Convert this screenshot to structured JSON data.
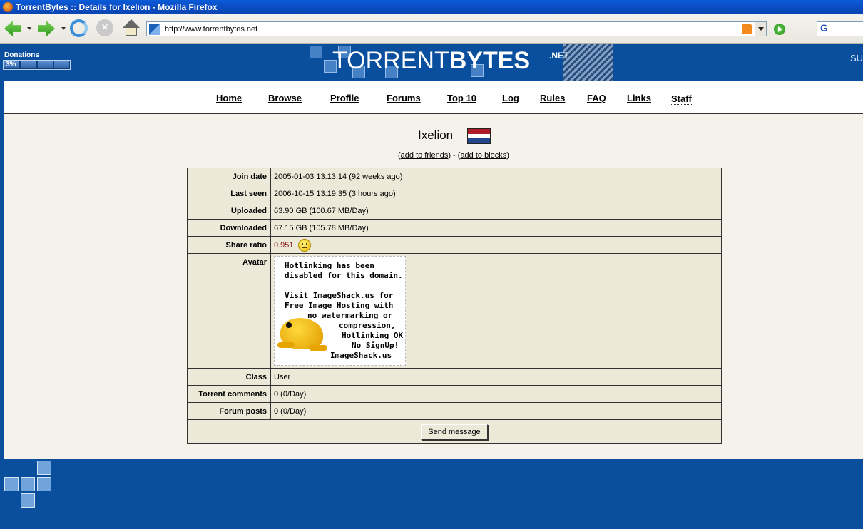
{
  "window": {
    "title": "TorrentBytes :: Details for Ixelion - Mozilla Firefox"
  },
  "toolbar": {
    "url": "http://www.torrentbytes.net",
    "search_engine_glyph": "G"
  },
  "header": {
    "donations_label": "Donations",
    "donations_percent": "3%",
    "donations_fraction": 0.03,
    "logo_word1": "TORRENT",
    "logo_word2": "BYTES",
    "logo_suffix": ".NET",
    "edge_text": "SU"
  },
  "nav": {
    "items": [
      "Home",
      "Browse",
      "Profile",
      "Forums",
      "Top 10",
      "Log",
      "Rules",
      "FAQ",
      "Links",
      "Staff"
    ]
  },
  "profile": {
    "username": "Ixelion",
    "flag_colors": [
      "#ae1c28",
      "#ffffff",
      "#21468b"
    ],
    "links": {
      "open": "(",
      "add_friends": "add to friends",
      "separator": ") - (",
      "add_blocks": "add to blocks",
      "close": ")"
    }
  },
  "details": {
    "rows": [
      {
        "label": "Join date",
        "value": "2005-01-03 13:13:14 (92 weeks ago)"
      },
      {
        "label": "Last seen",
        "value": "2006-10-15 13:19:35 (3 hours ago)"
      },
      {
        "label": "Uploaded",
        "value": "63.90 GB (100.67 MB/Day)"
      },
      {
        "label": "Downloaded",
        "value": "67.15 GB (105.78 MB/Day)"
      },
      {
        "label": "Share ratio",
        "value": "0.951"
      },
      {
        "label": "Avatar",
        "value": ""
      },
      {
        "label": "Class",
        "value": "User"
      },
      {
        "label": "Torrent comments",
        "value": "0 (0/Day)"
      },
      {
        "label": "Forum posts",
        "value": "0 (0/Day)"
      }
    ],
    "send_button": "Send message"
  },
  "avatar": {
    "lines": [
      "Hotlinking has been",
      "disabled for this domain.",
      "Visit ImageShack.us for",
      "Free Image Hosting with",
      "no watermarking or",
      "compression,",
      "Hotlinking OK",
      "No SignUp!",
      "ImageShack.us"
    ]
  }
}
